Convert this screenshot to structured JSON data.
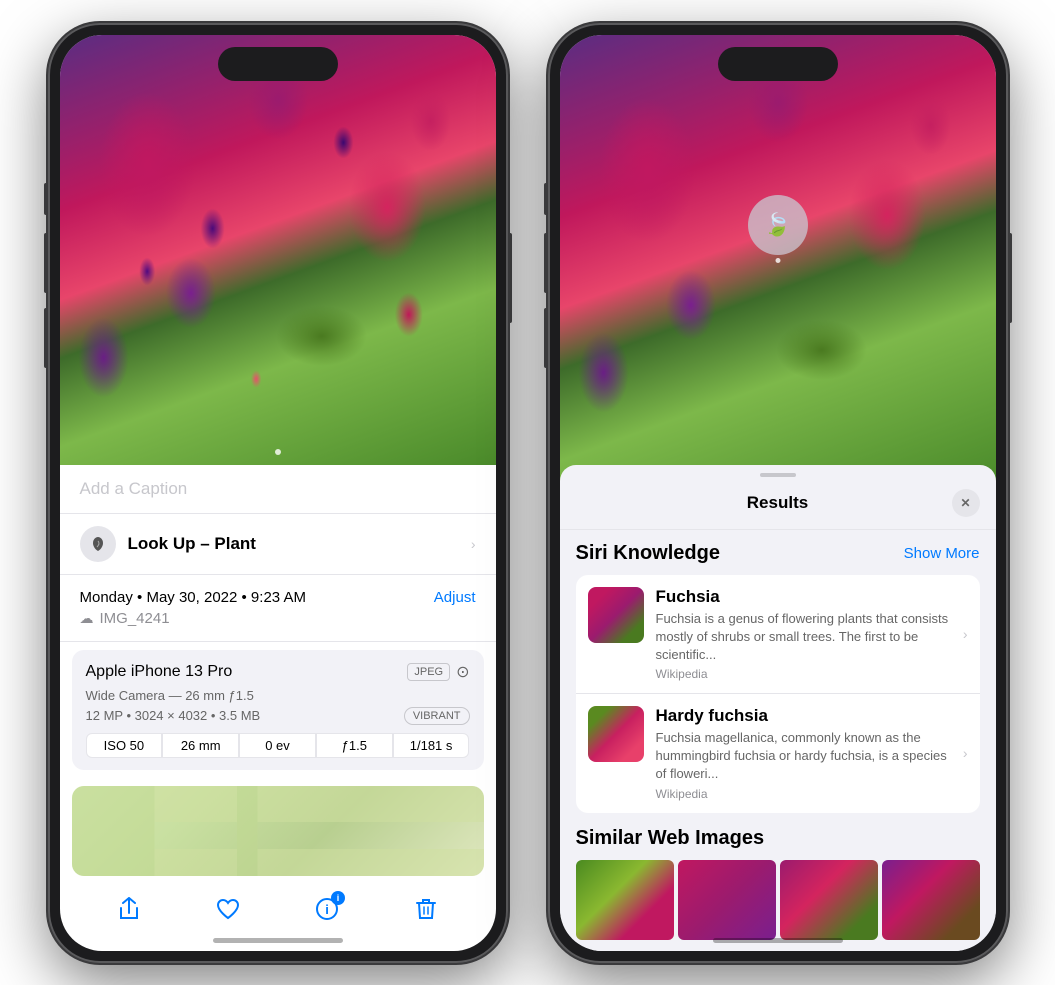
{
  "left_phone": {
    "caption_placeholder": "Add a Caption",
    "lookup_label_bold": "Look Up –",
    "lookup_label_normal": " Plant",
    "date": "Monday • May 30, 2022 • 9:23 AM",
    "adjust_btn": "Adjust",
    "filename": "IMG_4241",
    "device_name": "Apple iPhone 13 Pro",
    "jpeg_badge": "JPEG",
    "camera_details": "Wide Camera — 26 mm ƒ1.5",
    "mp_details": "12 MP • 3024 × 4032 • 3.5 MB",
    "vibrant_badge": "VIBRANT",
    "exif_iso": "ISO 50",
    "exif_mm": "26 mm",
    "exif_ev": "0 ev",
    "exif_aperture": "ƒ1.5",
    "exif_shutter": "1/181 s",
    "toolbar": {
      "share": "↑",
      "heart": "♡",
      "info": "✦",
      "delete": "🗑"
    }
  },
  "right_phone": {
    "results_title": "Results",
    "close_btn": "✕",
    "siri_knowledge_label": "Siri Knowledge",
    "show_more_btn": "Show More",
    "items": [
      {
        "name": "Fuchsia",
        "desc": "Fuchsia is a genus of flowering plants that consists mostly of shrubs or small trees. The first to be scientific...",
        "source": "Wikipedia"
      },
      {
        "name": "Hardy fuchsia",
        "desc": "Fuchsia magellanica, commonly known as the hummingbird fuchsia or hardy fuchsia, is a species of floweri...",
        "source": "Wikipedia"
      }
    ],
    "similar_title": "Similar Web Images"
  }
}
